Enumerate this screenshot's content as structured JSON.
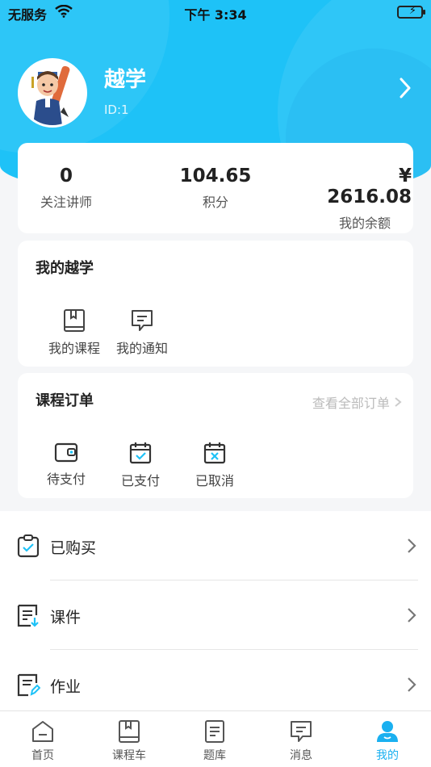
{
  "status_bar": {
    "carrier": "无服务",
    "time": "下午 3:34"
  },
  "profile": {
    "name": "越学",
    "id": "ID:1"
  },
  "stats": [
    {
      "value": "0",
      "label": "关注讲师"
    },
    {
      "value": "104.65",
      "label": "积分"
    },
    {
      "value": "¥ 2616.08",
      "label": "我的余额"
    }
  ],
  "my_section": {
    "title": "我的越学",
    "items": [
      {
        "label": "我的课程",
        "icon": "book-icon"
      },
      {
        "label": "我的通知",
        "icon": "message-icon"
      }
    ]
  },
  "orders_section": {
    "title": "课程订单",
    "view_all": "查看全部订单",
    "items": [
      {
        "label": "待支付",
        "icon": "wallet-icon"
      },
      {
        "label": "已支付",
        "icon": "calendar-check-icon"
      },
      {
        "label": "已取消",
        "icon": "calendar-x-icon"
      }
    ]
  },
  "menu": [
    {
      "label": "已购买",
      "icon": "clipboard-check-icon"
    },
    {
      "label": "课件",
      "icon": "document-download-icon"
    },
    {
      "label": "作业",
      "icon": "document-edit-icon"
    }
  ],
  "tabs": [
    {
      "label": "首页",
      "icon": "home-icon",
      "active": false
    },
    {
      "label": "课程车",
      "icon": "book-icon",
      "active": false
    },
    {
      "label": "题库",
      "icon": "document-icon",
      "active": false
    },
    {
      "label": "消息",
      "icon": "message-icon",
      "active": false
    },
    {
      "label": "我的",
      "icon": "user-icon",
      "active": true
    }
  ],
  "colors": {
    "accent": "#1ec2f7",
    "active_tab": "#1ab0f0",
    "order_icon_check": "#1ec2f7"
  }
}
